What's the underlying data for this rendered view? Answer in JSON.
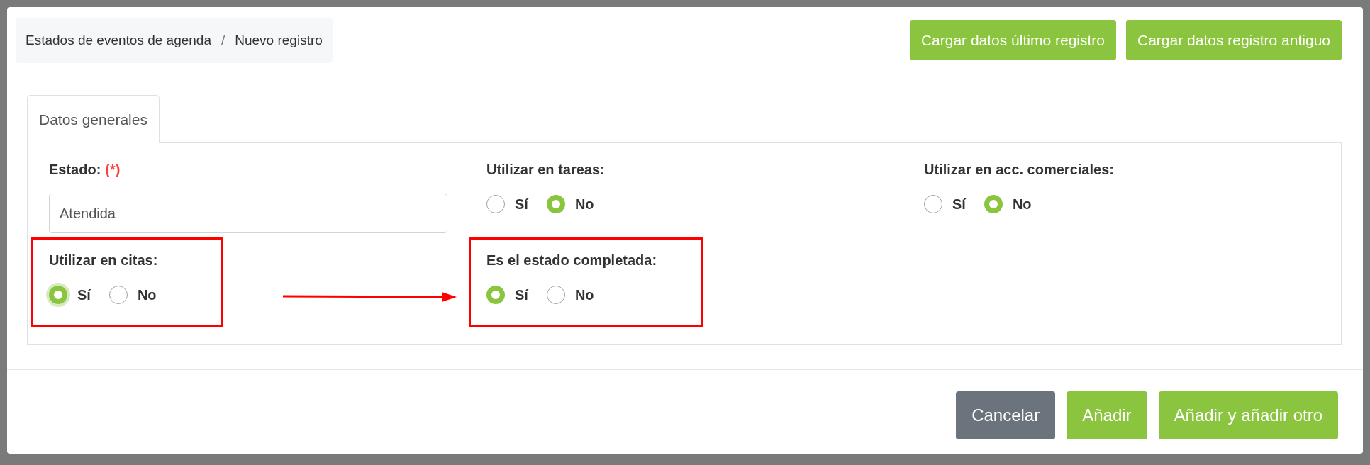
{
  "breadcrumb": [
    "Estados de eventos de agenda",
    "Nuevo registro"
  ],
  "breadcrumb_separator": "/",
  "header_buttons": [
    "Cargar datos último registro",
    "Cargar datos registro antiguo"
  ],
  "tabs": [
    {
      "label": "Datos generales",
      "selected": true
    }
  ],
  "fields": [
    {
      "kind": "text",
      "label": "Estado:",
      "required_mark": "(*)",
      "value": "Atendida",
      "highlighted": false
    },
    {
      "kind": "radio",
      "label": "Utilizar en tareas:",
      "highlighted": false,
      "options": [
        {
          "label": "Sí",
          "selected": false
        },
        {
          "label": "No",
          "selected": true
        }
      ]
    },
    {
      "kind": "radio",
      "label": "Utilizar en acc. comerciales:",
      "highlighted": false,
      "options": [
        {
          "label": "Sí",
          "selected": false
        },
        {
          "label": "No",
          "selected": true
        }
      ]
    },
    {
      "kind": "radio",
      "label": "Utilizar en citas:",
      "highlighted": true,
      "arrow_to_next": true,
      "options": [
        {
          "label": "Sí",
          "selected": true,
          "focused": true
        },
        {
          "label": "No",
          "selected": false
        }
      ]
    },
    {
      "kind": "radio",
      "label": "Es el estado completada:",
      "highlighted": true,
      "options": [
        {
          "label": "Sí",
          "selected": true
        },
        {
          "label": "No",
          "selected": false
        }
      ]
    }
  ],
  "footer_buttons": [
    {
      "kind": "secondary",
      "label": "Cancelar"
    },
    {
      "kind": "primary",
      "label": "Añadir"
    },
    {
      "kind": "primary",
      "label": "Añadir y añadir otro"
    }
  ]
}
